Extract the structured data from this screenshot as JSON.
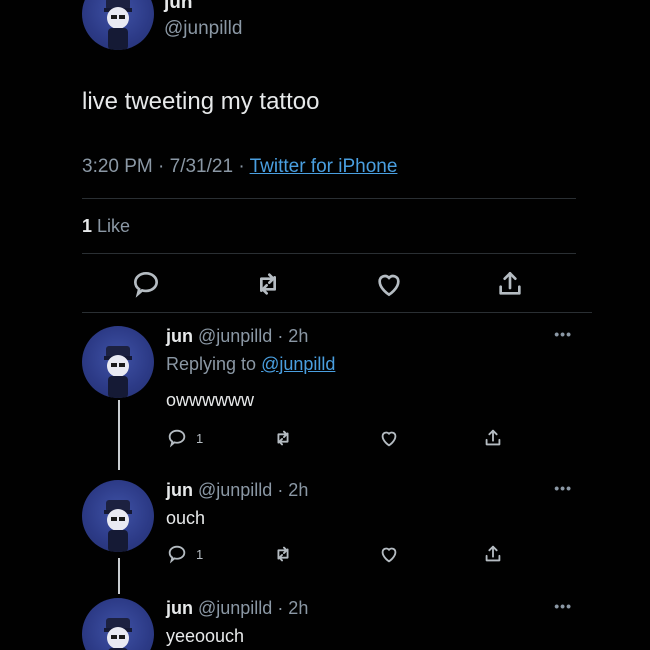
{
  "main_tweet": {
    "name": "jun",
    "handle": "@junpilld",
    "text": "live tweeting my tattoo",
    "timestamp": "3:20 PM · 7/31/21 · ",
    "source": "Twitter for iPhone",
    "like_count": "1",
    "like_label": " Like",
    "more_label": "•••"
  },
  "replies": [
    {
      "name": "jun",
      "handle_time": " @junpilld · 2h",
      "replying_prefix": "Replying to ",
      "replying_to": "@junpilld",
      "text": "owwwwww",
      "reply_count": "1",
      "more_label": "•••"
    },
    {
      "name": "jun",
      "handle_time": " @junpilld · 2h",
      "text": "ouch",
      "reply_count": "1",
      "more_label": "•••"
    },
    {
      "name": "jun",
      "handle_time": " @junpilld · 2h",
      "text": "yeeoouch",
      "more_label": "•••"
    }
  ],
  "colors": {
    "background": "#010101",
    "text_primary": "#e7e9ea",
    "text_secondary": "#8b98a5",
    "link": "#4a9fe0",
    "avatar": "#2c3a86",
    "divider": "#2a2f33"
  },
  "icons": {
    "reply": "speech-bubble-icon",
    "retweet": "retweet-icon",
    "like": "heart-icon",
    "share": "share-icon",
    "more": "more-dots-icon"
  }
}
